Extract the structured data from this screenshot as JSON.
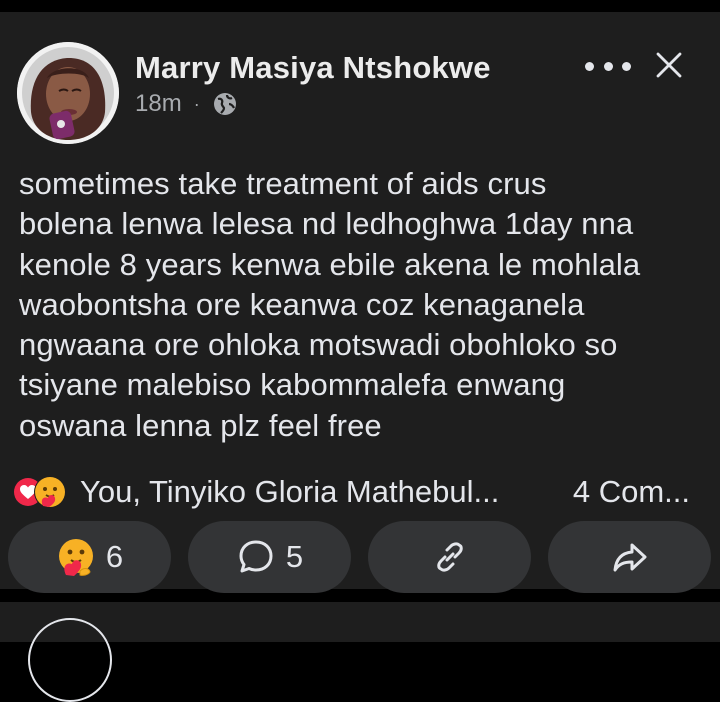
{
  "post": {
    "author": "Marry Masiya Ntshokwe",
    "time": "18m",
    "separator": "·",
    "body": "sometimes take treatment of aids crus\nbolena lenwa lelesa nd ledhoghwa 1day nna\nkenole 8 years kenwa ebile akena le mohlala\nwaobontsha ore keanwa coz kenaganela\nngwaana ore ohloka motswadi obohloko so\ntsiyane malebiso kabommalefa enwang\noswana lenna plz feel free"
  },
  "reactions": {
    "names": "You, Tinyiko Gloria Mathebul...",
    "comments": "4 Com..."
  },
  "actions": {
    "reaction_count": "6",
    "comment_count": "5"
  },
  "icons": {
    "privacy": "globe-icon",
    "more": "more-icon",
    "close": "close-icon",
    "reaction_1": "love-icon",
    "reaction_2": "care-icon",
    "comment": "comment-icon",
    "copy_link": "link-icon",
    "share": "share-icon"
  },
  "colors": {
    "background": "#000000",
    "card": "#1e1e1e",
    "button": "#333436",
    "text": "#e4e6eb",
    "muted": "#a8abaf",
    "love": "#f0284a",
    "care": "#f7b125"
  }
}
